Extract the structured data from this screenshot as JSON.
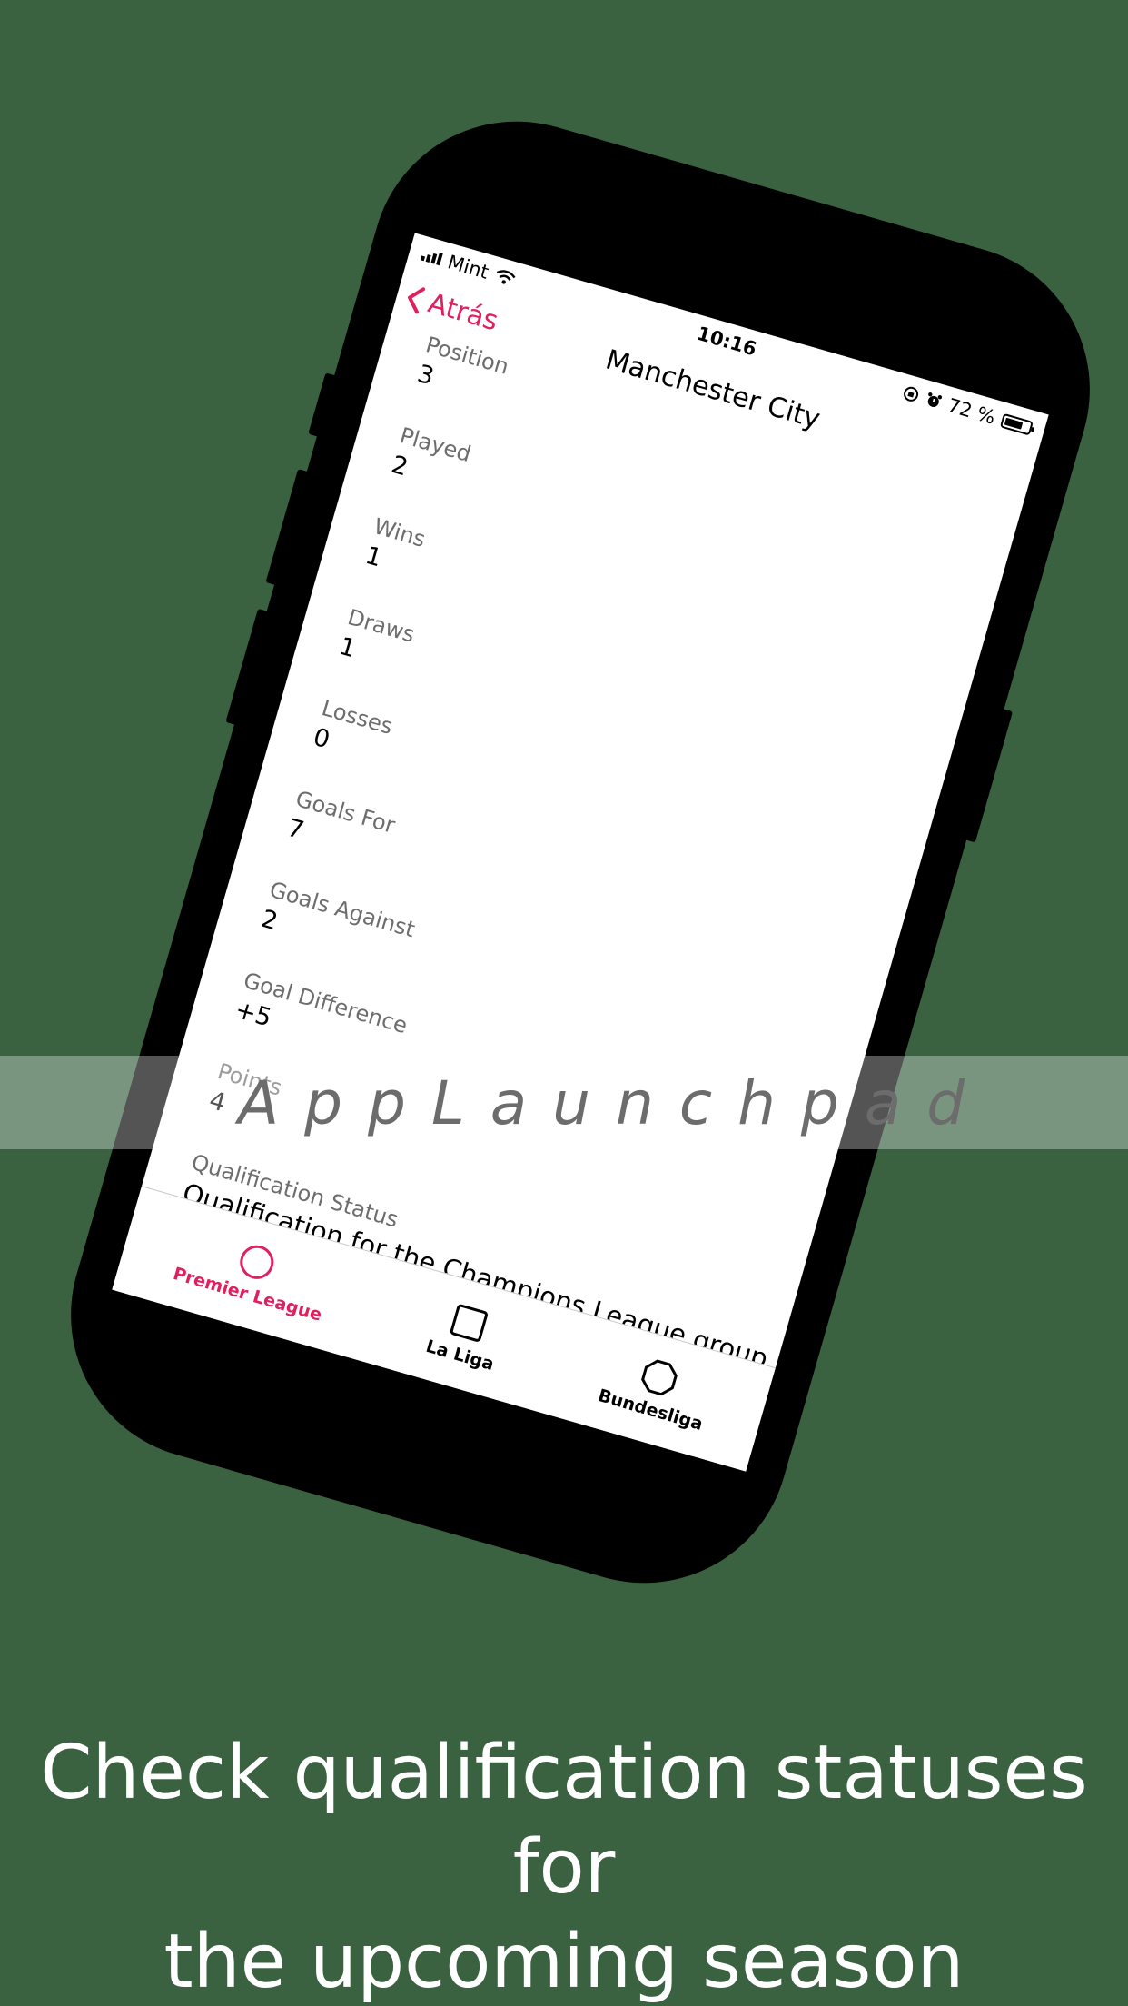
{
  "status_bar": {
    "carrier": "Mint",
    "time": "10:16",
    "battery_percent_text": "72 %",
    "battery_level": 0.72
  },
  "nav": {
    "back_label": "Atrás",
    "title": "Manchester City"
  },
  "stats": [
    {
      "label": "Position",
      "value": "3"
    },
    {
      "label": "Played",
      "value": "2"
    },
    {
      "label": "Wins",
      "value": "1"
    },
    {
      "label": "Draws",
      "value": "1"
    },
    {
      "label": "Losses",
      "value": "0"
    },
    {
      "label": "Goals For",
      "value": "7"
    },
    {
      "label": "Goals Against",
      "value": "2"
    },
    {
      "label": "Goal Difference",
      "value": "+5"
    },
    {
      "label": "Points",
      "value": "4"
    },
    {
      "label": "Qualification Status",
      "value": "Qualification for the Champions League group stage"
    }
  ],
  "tabs": [
    {
      "label": "Premier League",
      "icon": "circle-icon",
      "active": true
    },
    {
      "label": "La Liga",
      "icon": "square-icon",
      "active": false
    },
    {
      "label": "Bundesliga",
      "icon": "octagon-icon",
      "active": false
    }
  ],
  "watermark": "AppLaunchpad",
  "caption": {
    "line1": "Check qualification statuses for",
    "line2": "the upcoming season"
  },
  "colors": {
    "background": "#3a6140",
    "accent": "#e0205e",
    "text": "#000000",
    "label": "#6d6d6d"
  }
}
